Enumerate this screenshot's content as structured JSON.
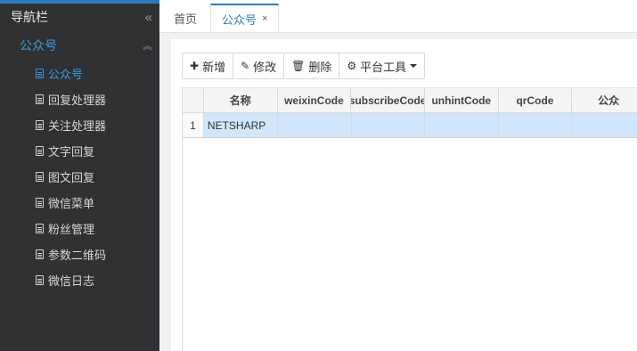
{
  "sidebar": {
    "header": "导航栏",
    "collapse_icon": "double-chevron-left-icon",
    "group": {
      "label": "公众号",
      "toggle_icon": "double-chevron-up-icon"
    },
    "items": [
      {
        "label": "公众号",
        "active": true
      },
      {
        "label": "回复处理器"
      },
      {
        "label": "关注处理器"
      },
      {
        "label": "文字回复"
      },
      {
        "label": "图文回复"
      },
      {
        "label": "微信菜单"
      },
      {
        "label": "粉丝管理"
      },
      {
        "label": "参数二维码"
      },
      {
        "label": "微信日志"
      }
    ]
  },
  "tabs": {
    "home": "首页",
    "active": "公众号",
    "close": "×"
  },
  "toolbar": {
    "add": "新增",
    "edit": "修改",
    "delete": "删除",
    "tools": "平台工具"
  },
  "grid": {
    "columns": [
      "名称",
      "weixinCode",
      "subscribeCode",
      "unhintCode",
      "qrCode",
      "公众"
    ],
    "rows": [
      {
        "num": "1",
        "cells": [
          "NETSHARP",
          "",
          "",
          "",
          "",
          ""
        ]
      }
    ]
  },
  "colors": {
    "accent": "#2b7bbf",
    "sidebar_bg": "#2f3133",
    "selected_row": "#cfe6fb"
  }
}
